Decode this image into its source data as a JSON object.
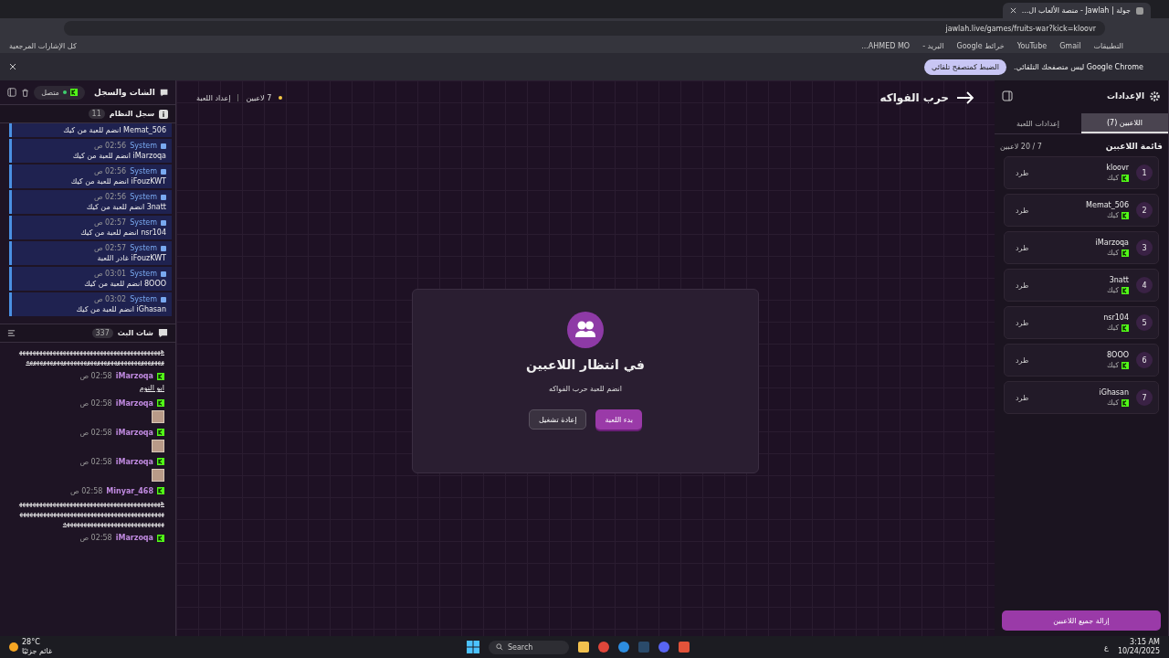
{
  "browser": {
    "tab_title": "جولة | Jawlah - منصة الألعاب ال...",
    "url": "jawlah.live/games/fruits-war?kick=kloovr",
    "bookmarks": [
      "التطبيقات",
      "Gmail",
      "YouTube",
      "خرائط Google",
      "البريد -",
      "AHMED MO..."
    ],
    "all_bookmarks": "كل الإشارات المرجعية",
    "infobar": {
      "message": "Google Chrome ليس متصفحك التلقائي.",
      "button": "الضبط كمتصفح تلقائي"
    }
  },
  "left_panel": {
    "title": "الشات والسجل",
    "status": "متصل",
    "connected": true,
    "system_log": {
      "title": "سجل النظام",
      "count": "11",
      "entries": [
        {
          "text": "Memat_506 انضم للعبة من كيك"
        },
        {
          "source": "System",
          "time": "02:56 ص",
          "text": "iMarzoqa انضم للعبة من كيك"
        },
        {
          "source": "System",
          "time": "02:56 ص",
          "text": "iFouzKWT انضم للعبة من كيك"
        },
        {
          "source": "System",
          "time": "02:56 ص",
          "text": "3natt انضم للعبة من كيك"
        },
        {
          "source": "System",
          "time": "02:57 ص",
          "text": "nsr104 انضم للعبة من كيك"
        },
        {
          "source": "System",
          "time": "02:57 ص",
          "text": "iFouzKWT غادر اللعبة"
        },
        {
          "source": "System",
          "time": "03:01 ص",
          "text": "8OOO انضم للعبة من كيك"
        },
        {
          "source": "System",
          "time": "03:02 ص",
          "text": "iGhasan انضم للعبة من كيك"
        }
      ]
    },
    "chat": {
      "title": "شات البث",
      "count": "337",
      "messages": [
        {
          "kind": "text",
          "text": "هههههههههههههههههههههههههههههههههههههههههههههههههههههههههههههههههههههههههههههههههههه"
        },
        {
          "kind": "text",
          "user": "iMarzoqa",
          "time": "02:58 ص",
          "text": "ابو النوم"
        },
        {
          "kind": "image",
          "user": "iMarzoqa",
          "time": "02:58 ص"
        },
        {
          "kind": "image",
          "user": "iMarzoqa",
          "time": "02:58 ص"
        },
        {
          "kind": "image",
          "user": "iMarzoqa",
          "time": "02:58 ص"
        },
        {
          "kind": "text",
          "user": "Minyar_468",
          "time": "02:58 ص",
          "text": "هههههههههههههههههههههههههههههههههههههههههههههههههههههههههههههههههههههههههههههههههههههههههههههههههههههههههههههههههههه"
        },
        {
          "kind": "text",
          "user": "iMarzoqa",
          "time": "02:58 ص"
        }
      ]
    }
  },
  "game": {
    "title": "حرب الفواكه",
    "players_count": "7 لاعبين",
    "setup_label": "إعداد اللعبة",
    "modal": {
      "title": "في انتظار اللاعبين",
      "subtitle": "انضم للعبة حرب الفواكه",
      "start_button": "بدء اللعبة",
      "restart_button": "إعادة تشغيل"
    }
  },
  "settings": {
    "title": "الإعدادات",
    "tabs": [
      {
        "label": "اللاعبين (7)",
        "selected": true
      },
      {
        "label": "إعدادات اللعبة",
        "selected": false
      }
    ],
    "list_title": "قائمة اللاعبين",
    "capacity": "7 / 20 لاعبين",
    "players": [
      {
        "rank": "1",
        "name": "kloovr",
        "platform": "كيك",
        "kick_label": "طرد"
      },
      {
        "rank": "2",
        "name": "Memat_506",
        "platform": "كيك",
        "kick_label": "طرد"
      },
      {
        "rank": "3",
        "name": "iMarzoqa",
        "platform": "كيك",
        "kick_label": "طرد"
      },
      {
        "rank": "4",
        "name": "3natt",
        "platform": "كيك",
        "kick_label": "طرد"
      },
      {
        "rank": "5",
        "name": "nsr104",
        "platform": "كيك",
        "kick_label": "طرد"
      },
      {
        "rank": "6",
        "name": "8OOO",
        "platform": "كيك",
        "kick_label": "طرد"
      },
      {
        "rank": "7",
        "name": "iGhasan",
        "platform": "كيك",
        "kick_label": "طرد"
      }
    ],
    "remove_all": "إزالة جميع اللاعبين"
  },
  "taskbar": {
    "temperature": "28°C",
    "weather": "غائم جزئيًا",
    "search": "Search",
    "language": "ع",
    "time": "3:15 AM",
    "date": "10/24/2025"
  }
}
